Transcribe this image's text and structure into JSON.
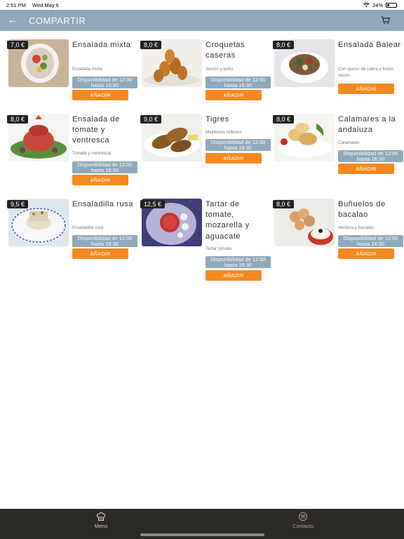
{
  "status_bar": {
    "time": "2:51 PM",
    "date": "Wed May 6",
    "battery": "24%"
  },
  "header": {
    "title": "COMPARTIR"
  },
  "availability": "Disponibilidad de 12:00 hasta 16:30",
  "add_label": "AÑADIR",
  "products": [
    {
      "name": "Ensalada mixta",
      "price": "7,0 €",
      "desc": "Ensalada mixta"
    },
    {
      "name": "Croquetas caseras",
      "price": "8,0 €",
      "desc": "Jamón y pollo"
    },
    {
      "name": "Ensalada Balear",
      "price": "8,0 €",
      "desc": "Con queso de cabra y frutos secos"
    },
    {
      "name": "Ensalada de tomate y ventresca",
      "price": "8,0 €",
      "desc": "Tomate y ventresca"
    },
    {
      "name": "Tigres",
      "price": "9,0 €",
      "desc": "Mejillones rellenos"
    },
    {
      "name": "Calamares a la andaluza",
      "price": "8,0 €",
      "desc": "Calamares"
    },
    {
      "name": "Ensaladilla rusa",
      "price": "9,5 €",
      "desc": "Ensaladilla rusa"
    },
    {
      "name": "Tartar de tomate, mozarella y aguacate",
      "price": "12,5 €",
      "desc": "Tartar tomate"
    },
    {
      "name": "Buñuelos de bacalao",
      "price": "8,0 €",
      "desc": "Verdura y bacalao"
    }
  ],
  "tabs": {
    "menu": "Menú",
    "contact": "Contacto"
  },
  "colors": {
    "header": "#8fa9bb",
    "button": "#f5891f",
    "tabbar": "#2b2a26"
  }
}
